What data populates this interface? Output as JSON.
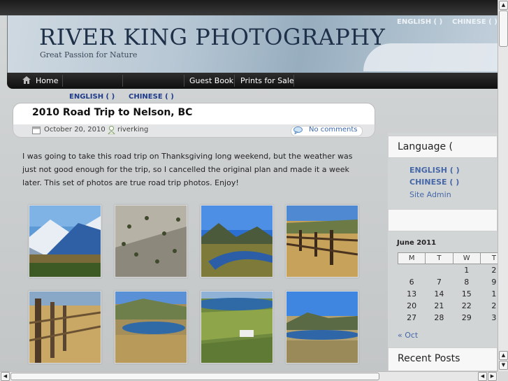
{
  "header": {
    "site_title": "RIVER KING PHOTOGRAPHY",
    "site_description": "Great Passion for Nature",
    "lang_english": "ENGLISH (   )",
    "lang_chinese": "CHINESE (   )"
  },
  "nav": {
    "items": [
      "Home",
      "Guest Book",
      "Prints for Sale"
    ]
  },
  "top_lang": {
    "english": "ENGLISH (    )",
    "chinese": "CHINESE (    )"
  },
  "post": {
    "title": "2010 Road Trip to Nelson, BC",
    "date": "October 20, 2010",
    "author": "riverking",
    "comments": "No comments",
    "body": "I was going to take this road trip on Thanksgiving long weekend, but the weather was just not good enough for the trip, so I cancelled the original plan and made it a week later.  This set of photos are true road trip photos.  Enjoy!"
  },
  "sidebar": {
    "language_title": "Language (",
    "english": "ENGLISH (    )",
    "chinese": "CHINESE (    )",
    "site_admin": "Site Admin",
    "recent_posts_title": "Recent Posts"
  },
  "calendar": {
    "caption": "June 2011",
    "headers": [
      "M",
      "T",
      "W",
      "T"
    ],
    "rows": [
      [
        "",
        "",
        "1",
        "2"
      ],
      [
        "6",
        "7",
        "8",
        "9"
      ],
      [
        "13",
        "14",
        "15",
        "1"
      ],
      [
        "20",
        "21",
        "22",
        "2"
      ],
      [
        "27",
        "28",
        "29",
        "3"
      ]
    ],
    "prev": "« Oct"
  },
  "colors": {
    "link": "#1e3b8a",
    "nav_bg": "#1a1a1a",
    "title_color": "#1f3049"
  }
}
